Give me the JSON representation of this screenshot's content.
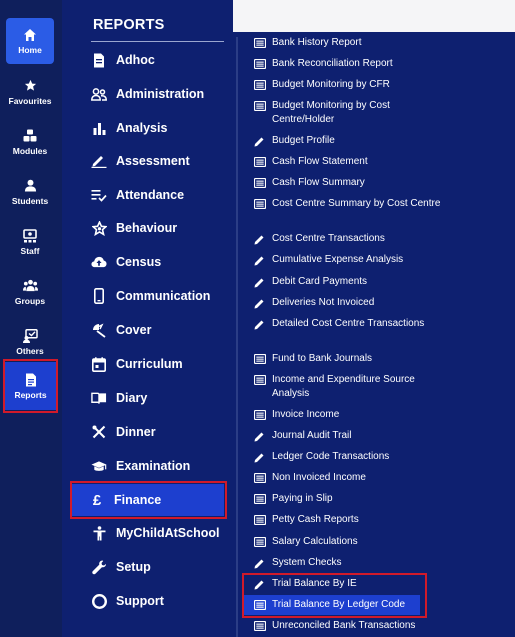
{
  "rail": [
    {
      "label": "Home",
      "icon": "home-icon"
    },
    {
      "label": "Favourites",
      "icon": "star-icon"
    },
    {
      "label": "Modules",
      "icon": "modules-icon"
    },
    {
      "label": "Students",
      "icon": "student-icon"
    },
    {
      "label": "Staff",
      "icon": "staff-icon"
    },
    {
      "label": "Groups",
      "icon": "groups-icon"
    },
    {
      "label": "Others",
      "icon": "others-icon"
    },
    {
      "label": "Reports",
      "icon": "report-icon"
    }
  ],
  "categories": {
    "title": "REPORTS",
    "items": [
      {
        "label": "Adhoc",
        "icon": "document-icon"
      },
      {
        "label": "Administration",
        "icon": "people-icon"
      },
      {
        "label": "Analysis",
        "icon": "bar-chart-icon"
      },
      {
        "label": "Assessment",
        "icon": "pencil-line-icon"
      },
      {
        "label": "Attendance",
        "icon": "checklist-icon"
      },
      {
        "label": "Behaviour",
        "icon": "star-badge-icon"
      },
      {
        "label": "Census",
        "icon": "cloud-upload-icon"
      },
      {
        "label": "Communication",
        "icon": "phone-icon"
      },
      {
        "label": "Cover",
        "icon": "cover-icon"
      },
      {
        "label": "Curriculum",
        "icon": "calendar-icon"
      },
      {
        "label": "Diary",
        "icon": "book-icon"
      },
      {
        "label": "Dinner",
        "icon": "cutlery-icon"
      },
      {
        "label": "Examination",
        "icon": "graduation-cap-icon"
      },
      {
        "label": "Finance",
        "icon": "pound-icon"
      },
      {
        "label": "MyChildAtSchool",
        "icon": "child-icon"
      },
      {
        "label": "Setup",
        "icon": "wrench-icon"
      },
      {
        "label": "Support",
        "icon": "lifebuoy-icon"
      }
    ]
  },
  "reports": [
    {
      "label": "Bank History Report",
      "icon": "report-list-icon"
    },
    {
      "label": "Bank Reconciliation Report",
      "icon": "report-list-icon"
    },
    {
      "label": "Budget Monitoring by CFR",
      "icon": "report-list-icon"
    },
    {
      "label": "Budget Monitoring by Cost Centre/Holder",
      "icon": "report-list-icon"
    },
    {
      "label": "Budget Profile",
      "icon": "pencil-icon"
    },
    {
      "label": "Cash Flow Statement",
      "icon": "report-list-icon"
    },
    {
      "label": "Cash Flow Summary",
      "icon": "report-list-icon"
    },
    {
      "label": "Cost Centre Summary by Cost Centre",
      "icon": "report-list-icon"
    },
    {
      "label": "Cost Centre Transactions",
      "icon": "pencil-icon"
    },
    {
      "label": "Cumulative Expense Analysis",
      "icon": "pencil-icon"
    },
    {
      "label": "Debit Card Payments",
      "icon": "pencil-icon"
    },
    {
      "label": "Deliveries Not Invoiced",
      "icon": "pencil-icon"
    },
    {
      "label": "Detailed Cost Centre Transactions",
      "icon": "pencil-icon"
    },
    {
      "label": "Fund to Bank Journals",
      "icon": "report-list-icon"
    },
    {
      "label": "Income and Expenditure Source Analysis",
      "icon": "report-list-icon"
    },
    {
      "label": "Invoice Income",
      "icon": "report-list-icon"
    },
    {
      "label": "Journal Audit Trail",
      "icon": "pencil-icon"
    },
    {
      "label": "Ledger Code Transactions",
      "icon": "pencil-icon"
    },
    {
      "label": "Non Invoiced Income",
      "icon": "report-list-icon"
    },
    {
      "label": "Paying in Slip",
      "icon": "report-list-icon"
    },
    {
      "label": "Petty Cash Reports",
      "icon": "report-list-icon"
    },
    {
      "label": "Salary Calculations",
      "icon": "report-list-icon"
    },
    {
      "label": "System Checks",
      "icon": "pencil-icon"
    },
    {
      "label": "Trial Balance By IE",
      "icon": "pencil-icon"
    },
    {
      "label": "Trial Balance By Ledger Code",
      "icon": "report-list-icon"
    },
    {
      "label": "Unreconciled Bank Transactions",
      "icon": "report-list-icon"
    }
  ],
  "colors": {
    "rail_bg": "#0f1f5c",
    "panel_bg": "#0e2070",
    "active_bg": "#1d3fcf",
    "home_bg": "#2b5ce6",
    "highlight_border": "#d11a2a"
  }
}
